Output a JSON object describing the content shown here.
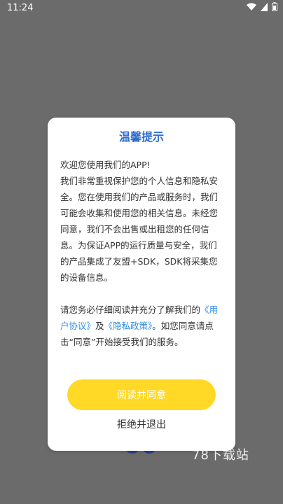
{
  "status_bar": {
    "time": "11:24",
    "icons": [
      "wifi-icon",
      "signal-icon",
      "battery-icon"
    ]
  },
  "background": {
    "watermark": "78下载站"
  },
  "dialog": {
    "title": "温馨提示",
    "para1_line1": "欢迎您使用我们的APP!",
    "para1_rest": "我们非常重视保护您的个人信息和隐私安全。您在使用我们的产品或服务时，我们可能会收集和使用您的相关信息。未经您同意，我们不会出售或出租您的任何信息。为保证APP的运行质量与安全，我们的产品集成了友盟+SDK，SDK将采集您的设备信息。",
    "para2_prefix": "请您务必仔细阅读并充分了解我们的",
    "link_user_agreement": "《用户协议》",
    "and_text": "及",
    "link_privacy_policy": "《隐私政策》",
    "para2_suffix": "。如您同意请点击“同意”开始接受我们的服务。",
    "agree_button": "阅读并同意",
    "exit_button": "拒绝并退出"
  },
  "colors": {
    "overlay": "#6b6b6b",
    "title": "#2e6bd1",
    "link": "#2e8ae6",
    "agree_button_bg": "#ffd925"
  }
}
